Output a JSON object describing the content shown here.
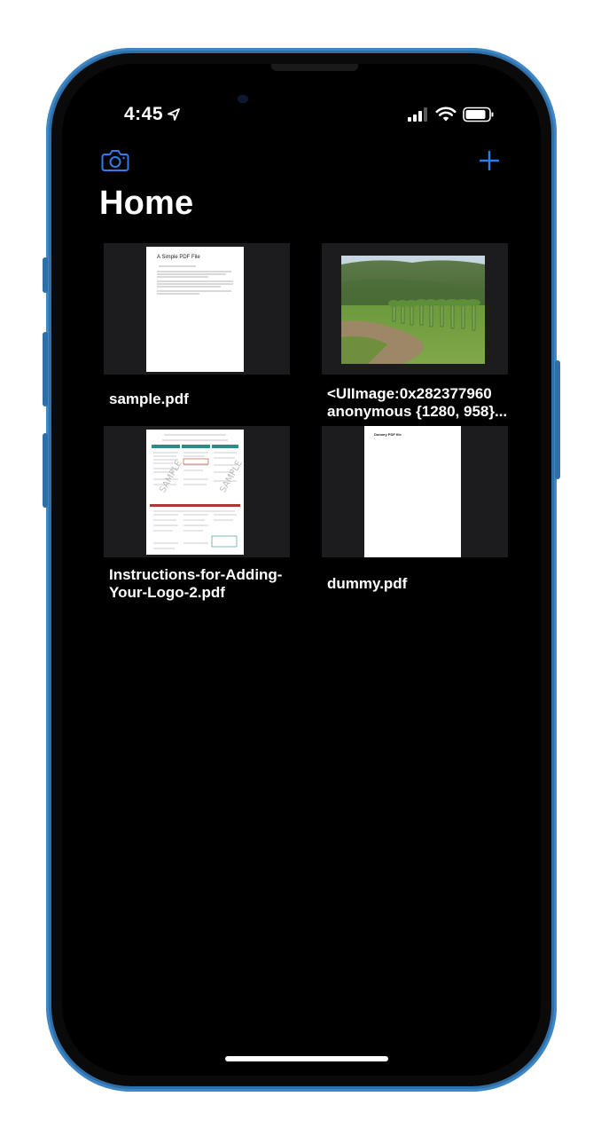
{
  "status_bar": {
    "time": "4:45",
    "location_icon": "location-arrow-icon",
    "signal_icon": "cellular-signal-icon",
    "wifi_icon": "wifi-icon",
    "battery_icon": "battery-icon"
  },
  "nav": {
    "camera_icon": "camera-icon",
    "add_icon": "plus-icon",
    "title": "Home"
  },
  "colors": {
    "accent": "#2f7dea",
    "background": "#000000",
    "thumb_bg": "#1c1c1e"
  },
  "documents": [
    {
      "name": "sample.pdf",
      "thumb_title": "A Simple PDF File",
      "kind": "pdf"
    },
    {
      "name": "<UIImage:0x282377960\nanonymous {1280, 958}...",
      "kind": "image"
    },
    {
      "name": "Instructions-for-Adding-\nYour-Logo-2.pdf",
      "kind": "pdf"
    },
    {
      "name": "dummy.pdf",
      "thumb_title": "Dummy PDF file",
      "kind": "pdf"
    }
  ]
}
